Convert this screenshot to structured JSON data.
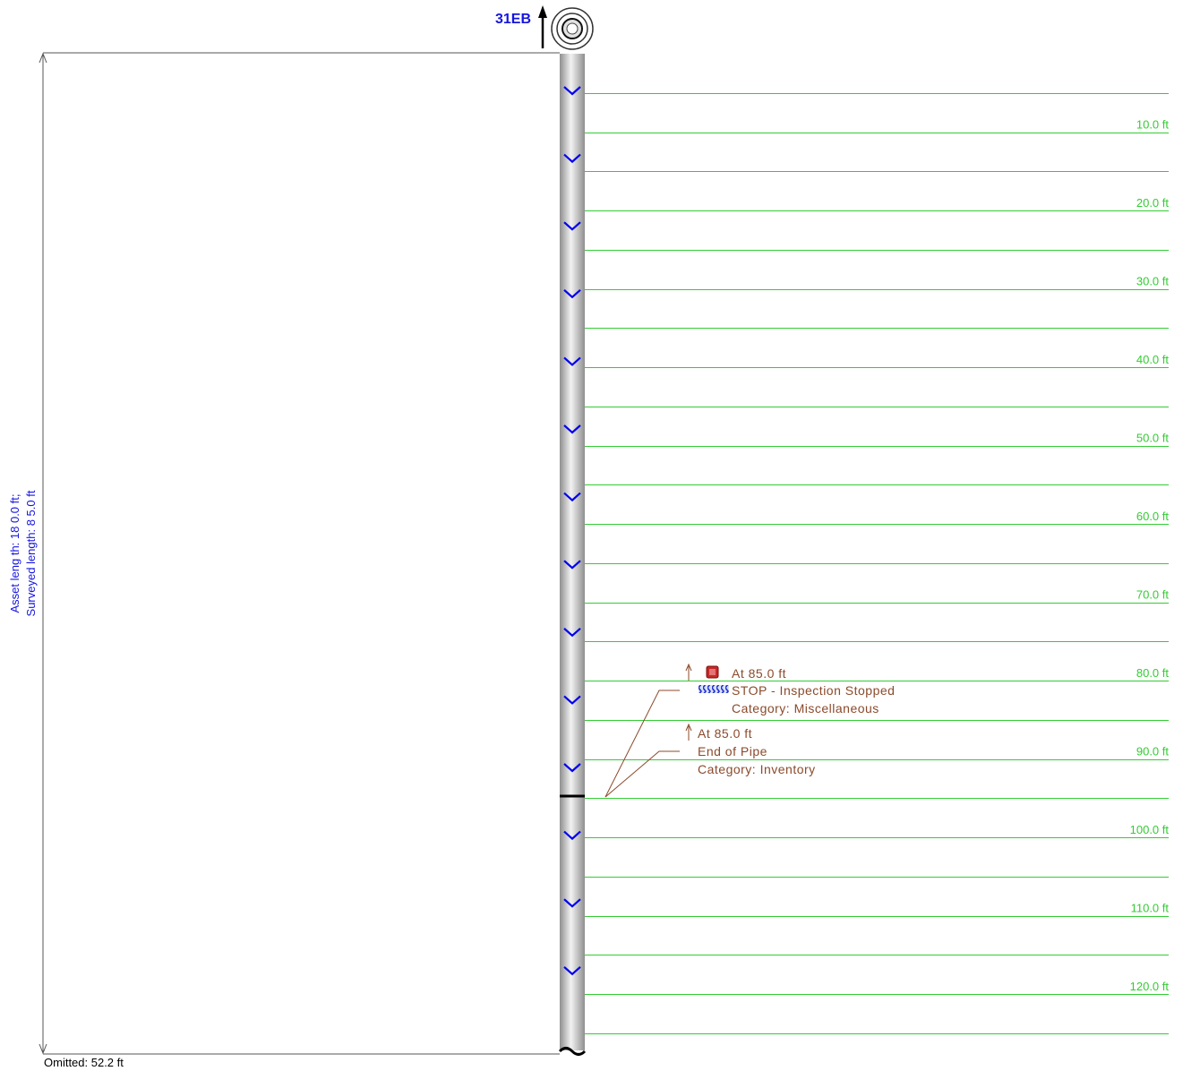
{
  "manhole": {
    "id": "31EB"
  },
  "asset_info": {
    "asset_length": "Asset leng th: 18 0.0 ft;",
    "surveyed_length": "Surveyed length: 8 5.0 ft"
  },
  "omitted": "Omitted: 52.2 ft",
  "scale": {
    "distances_ft": [
      10,
      20,
      30,
      40,
      50,
      60,
      70,
      80,
      90,
      100,
      110,
      120
    ],
    "labels": [
      "10.0 ft",
      "20.0 ft",
      "30.0 ft",
      "40.0 ft",
      "50.0 ft",
      "60.0 ft",
      "70.0 ft",
      "80.0 ft",
      "90.0 ft",
      "100.0 ft",
      "110.0 ft",
      "120.0 ft"
    ]
  },
  "observations": [
    {
      "at": "At 85.0 ft",
      "code_desc": "STOP - Inspection Stopped",
      "category": "Category: Miscellaneous",
      "icon": "stop-square-icon"
    },
    {
      "at": "At 85.0 ft",
      "code_desc": "End of Pipe",
      "category": "Category: Inventory",
      "icon": "none"
    }
  ],
  "colors": {
    "grid": "#33cc33",
    "observation_text": "#8b4a2b",
    "flow_arrows": "#0000ee",
    "asset_text": "#1515e0"
  },
  "flow_direction": "downstream"
}
